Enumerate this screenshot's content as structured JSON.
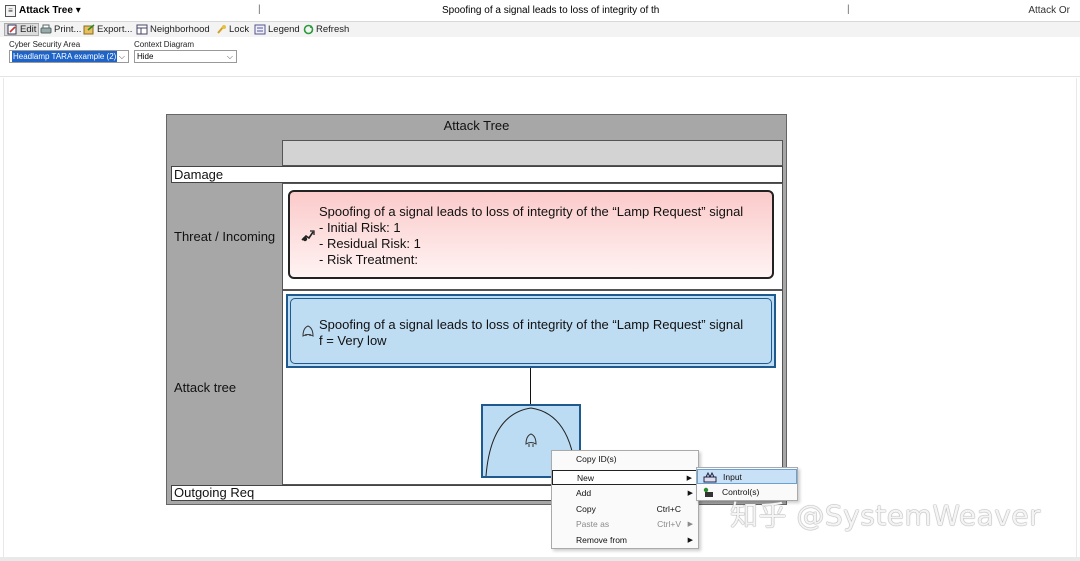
{
  "titlebar": {
    "app_icon": "document-icon",
    "view_title": "Attack Tree ▾",
    "separator": "|",
    "center_title": "Spoofing of a signal leads to loss of integrity of th",
    "right_title": "Attack Or"
  },
  "toolbar": {
    "edit": "Edit",
    "print": "Print...",
    "export": "Export...",
    "neighborhood": "Neighborhood",
    "lock": "Lock",
    "legend": "Legend",
    "refresh": "Refresh"
  },
  "params": {
    "cyber_area_label": "Cyber Security Area",
    "cyber_area_value": "Headlamp TARA example (2)",
    "context_label": "Context Diagram",
    "context_value": "Hide"
  },
  "diagram": {
    "title": "Attack Tree",
    "lanes": {
      "damage": "Damage",
      "threat": "Threat / Incoming",
      "attack": "Attack tree",
      "outgoing": "Outgoing Req"
    },
    "threat_box": {
      "title": "Spoofing of a signal leads to loss of integrity of the “Lamp Request” signal",
      "initial_risk": "- Initial Risk: 1",
      "residual_risk": "- Residual Risk: 1",
      "risk_treatment": "- Risk Treatment:"
    },
    "attack_box": {
      "title": "Spoofing of a signal leads to loss of integrity of the “Lamp Request” signal",
      "frequency": "f = Very low"
    }
  },
  "context_menu": {
    "items": [
      {
        "label": "Copy ID(s)",
        "shortcut": "",
        "submenu": false,
        "disabled": false
      },
      {
        "label": "New",
        "shortcut": "",
        "submenu": true,
        "disabled": false
      },
      {
        "label": "Add",
        "shortcut": "",
        "submenu": true,
        "disabled": false
      },
      {
        "label": "Copy",
        "shortcut": "Ctrl+C",
        "submenu": false,
        "disabled": false
      },
      {
        "label": "Paste as",
        "shortcut": "Ctrl+V",
        "submenu": true,
        "disabled": true
      },
      {
        "label": "Remove from",
        "shortcut": "",
        "submenu": true,
        "disabled": false
      }
    ],
    "arrow": "▶"
  },
  "submenu": {
    "items": [
      {
        "label": "Input",
        "icon": "input-node-icon"
      },
      {
        "label": "Control(s)",
        "icon": "control-node-icon"
      }
    ]
  },
  "watermark": "知乎 @SystemWeaver",
  "colors": {
    "threat_fill": "#fbcaca",
    "attack_fill": "#bcdcf3",
    "attack_border": "#1e5a8e",
    "lane_gray": "#a7a7a7"
  }
}
